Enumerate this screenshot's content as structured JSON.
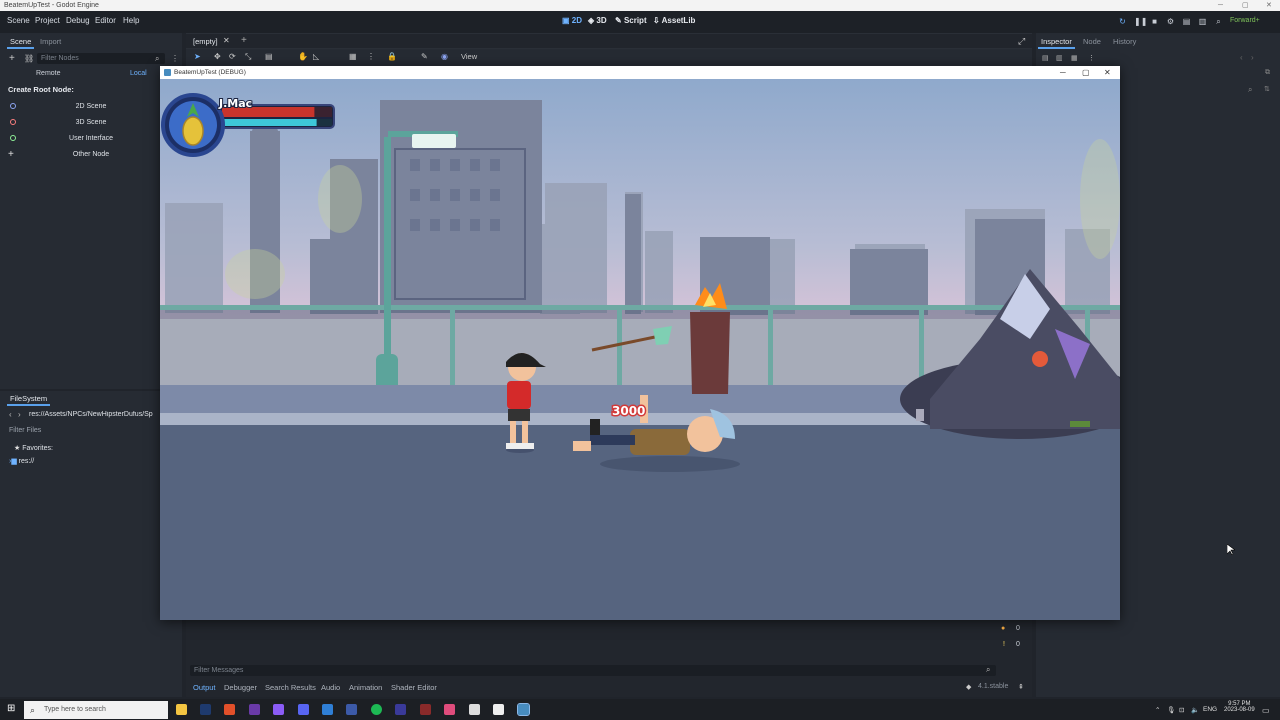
{
  "os_window": {
    "title": "BeatemUpTest - Godot Engine"
  },
  "menu": [
    "Scene",
    "Project",
    "Debug",
    "Editor",
    "Help"
  ],
  "workspaces": [
    {
      "label": "2D",
      "active": true
    },
    {
      "label": "3D",
      "active": false
    },
    {
      "label": "Script",
      "active": false
    },
    {
      "label": "AssetLib",
      "active": false
    }
  ],
  "renderer": "Forward+",
  "scene_dock": {
    "tabs": [
      "Scene",
      "Import"
    ],
    "filter_placeholder": "Filter Nodes",
    "remote_label": "Remote",
    "local_label": "Local",
    "create_root_label": "Create Root Node:",
    "root_options": [
      {
        "label": "2D Scene",
        "color": "#8da5f3"
      },
      {
        "label": "3D Scene",
        "color": "#fc7f7f"
      },
      {
        "label": "User Interface",
        "color": "#8eef97"
      },
      {
        "label": "Other Node",
        "color": "#e0e0e0"
      }
    ]
  },
  "filesystem": {
    "title": "FileSystem",
    "path": "res://Assets/NPCs/NewHipsterDufus/Sp",
    "filter_placeholder": "Filter Files",
    "favorites_label": "Favorites:",
    "root_label": "res://"
  },
  "editor": {
    "tab_label": "[empty]",
    "view_menu": "View"
  },
  "game_window": {
    "title": "BeatemUpTest (DEBUG)",
    "player_name": "J.Mac",
    "health_fraction": 0.84,
    "special_fraction": 0.86,
    "damage_popup": "3000"
  },
  "bottom_panel": {
    "filter_placeholder": "Filter Messages",
    "tabs": [
      "Output",
      "Debugger",
      "Search Results",
      "Audio",
      "Animation",
      "Shader Editor"
    ],
    "active_tab": "Output",
    "error_count": "0",
    "warning_count": "0",
    "version": "4.1.stable"
  },
  "inspector": {
    "tabs": [
      "Inspector",
      "Node",
      "History"
    ]
  },
  "taskbar": {
    "search_placeholder": "Type here to search",
    "language": "ENG",
    "time": "9:57 PM",
    "date": "2023-08-09"
  }
}
